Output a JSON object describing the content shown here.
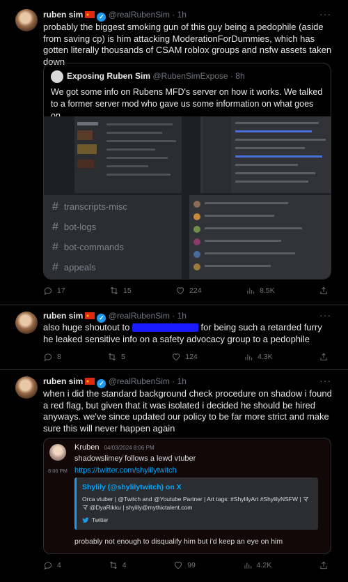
{
  "tweets": [
    {
      "author": "ruben sim",
      "handle": "@realRubenSim",
      "time": "· 1h",
      "text": "probably the biggest smoking gun of this guy being a pedophile (aside from saving cp) is him attacking ModerationForDummies, which has gotten literally thousands of CSAM roblox groups and nsfw assets taken down",
      "quote": {
        "author": "Exposing Ruben Sim",
        "handle": "@RubenSimExpose",
        "time": "· 8h",
        "text": "We got some info on Rubens MFD's server on how it works. We talked to a former server mod who gave us some information on what goes on.",
        "channels": [
          "transcripts-misc",
          "bot-logs",
          "bot-commands",
          "appeals"
        ]
      },
      "stats": {
        "replies": "17",
        "retweets": "15",
        "likes": "224",
        "views": "8.5K"
      }
    },
    {
      "author": "ruben sim",
      "handle": "@realRubenSim",
      "time": "· 1h",
      "text_before": "also huge shoutout to ",
      "text_after": " for being such a retarded furry he leaked sensitive info on a safety advocacy group to a pedophile",
      "stats": {
        "replies": "8",
        "retweets": "5",
        "likes": "124",
        "views": "4.3K"
      }
    },
    {
      "author": "ruben sim",
      "handle": "@realRubenSim",
      "time": "· 1h",
      "text": "when i did the standard background check procedure on shadow i found a red flag, but given that it was isolated i decided he should be hired anyways. we've since updated our policy to be far more strict and make sure this will never happen again",
      "embed": {
        "user": "Kruben",
        "date": "04/03/2024 8:06 PM",
        "line1": "shadowslimey follows a lewd vtuber",
        "side_time": "8:06 PM",
        "link": "https://twitter.com/shylilytwitch",
        "card_title": "Shylily (@shylilytwitch) on X",
        "card_desc": "Orca vtuber | @Twitch and @Youtube Partner | Art tags: #ShylilyArt #ShylilyNSFW | ママ @DyaRikku | shylily@mythictalent.com",
        "card_source": "Twitter",
        "line2": "probably not enough to disqualify him but i'd keep an eye on him"
      },
      "stats": {
        "replies": "4",
        "retweets": "4",
        "likes": "99",
        "views": "4.2K"
      }
    }
  ]
}
